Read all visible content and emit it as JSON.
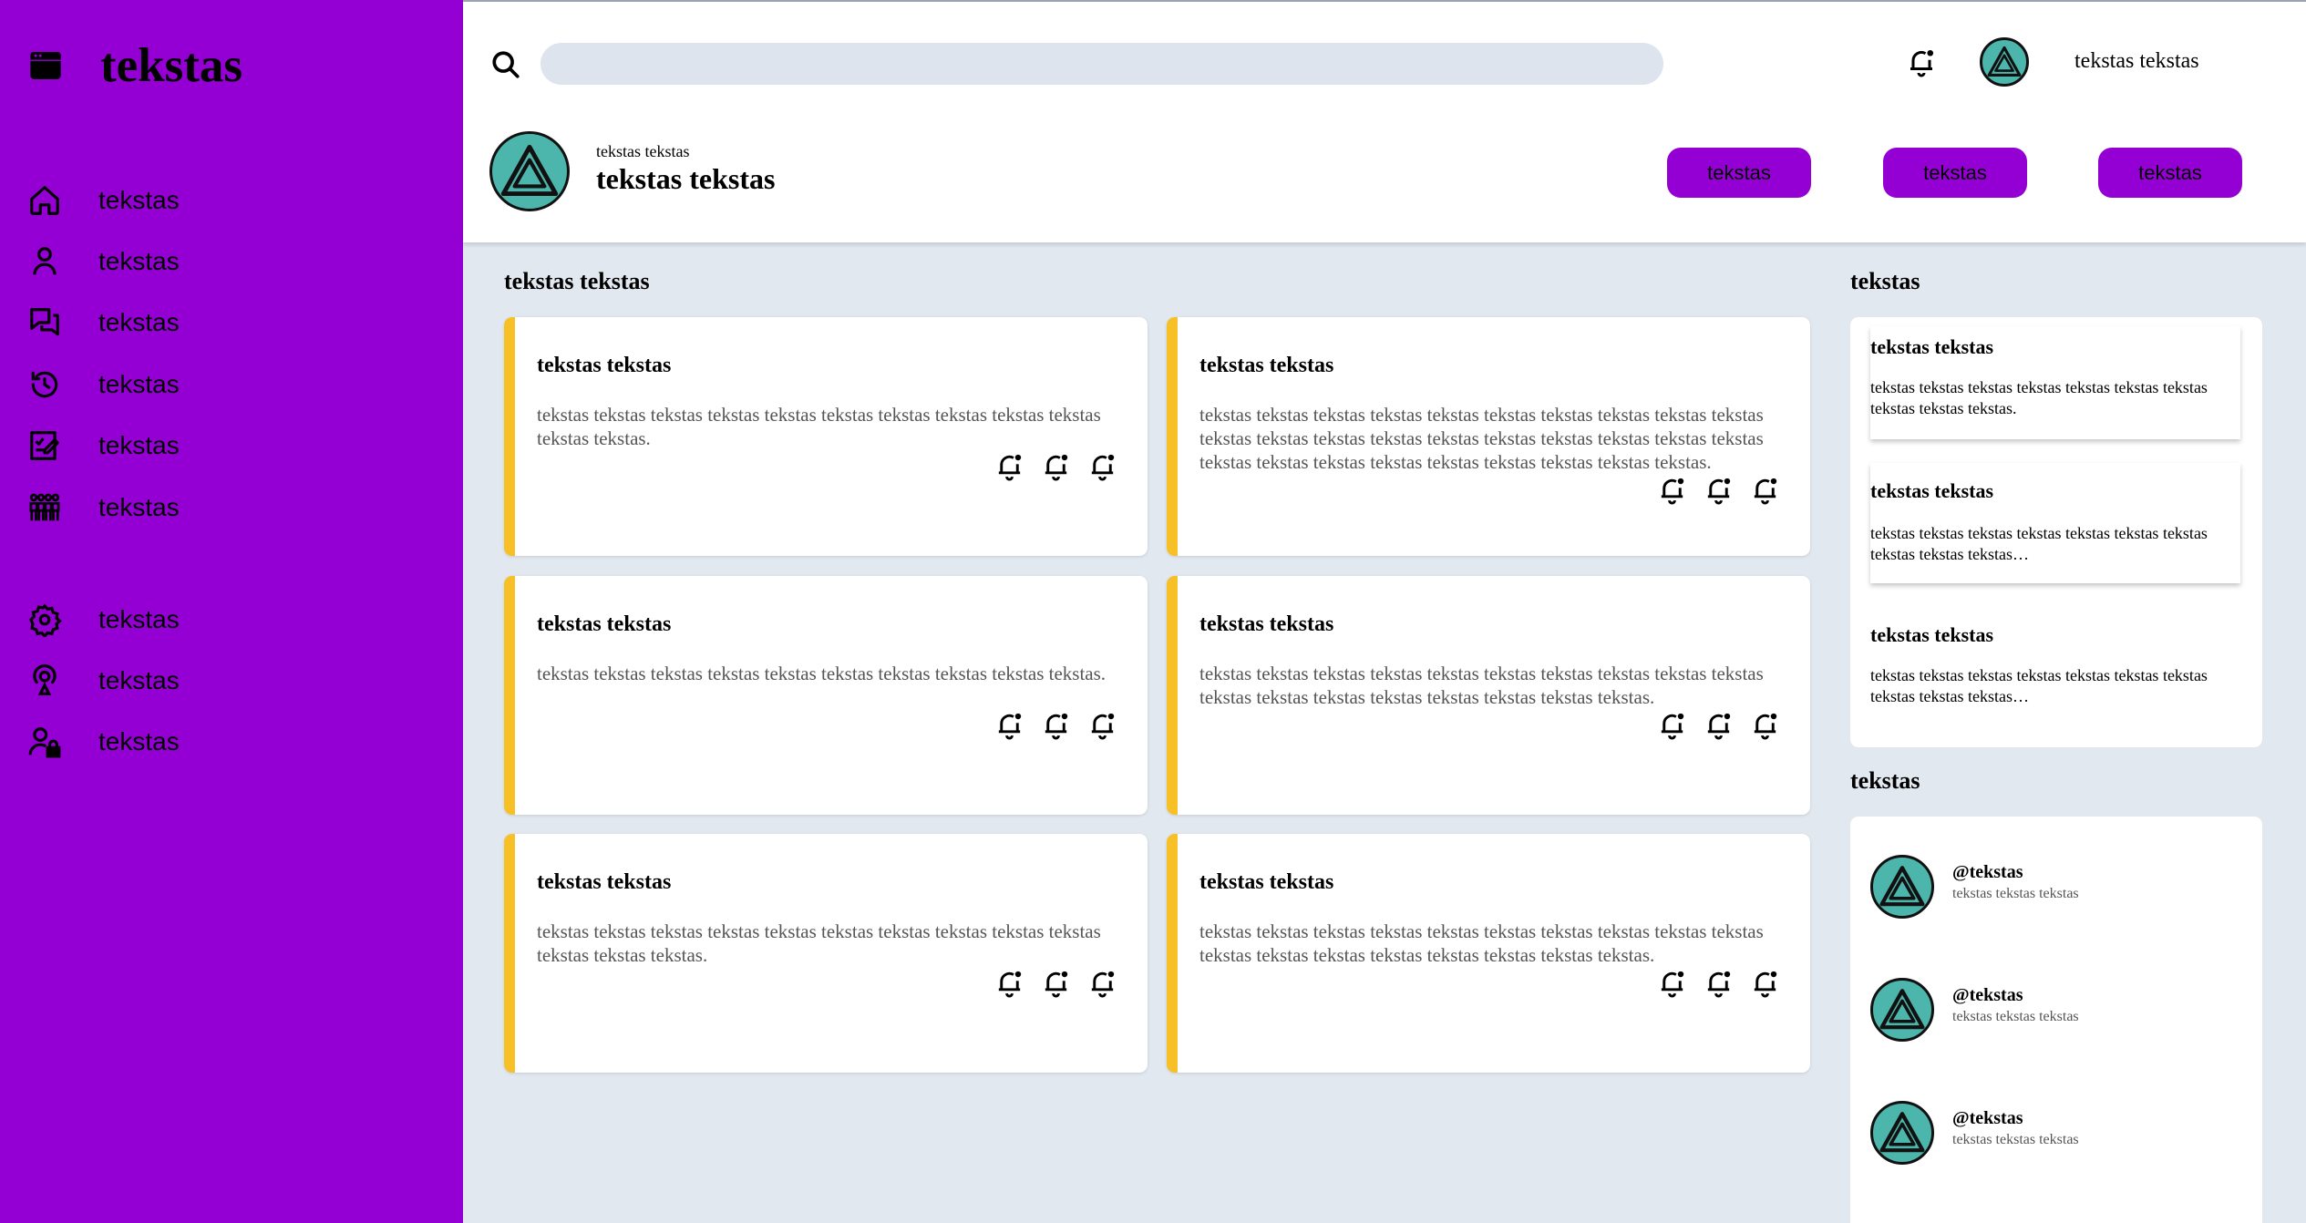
{
  "sidebar": {
    "brand_icon": "app-window-icon",
    "title": "tekstas",
    "items": [
      {
        "icon": "home-icon",
        "label": "tekstas"
      },
      {
        "icon": "user-icon",
        "label": "tekstas"
      },
      {
        "icon": "chat-icon",
        "label": "tekstas"
      },
      {
        "icon": "history-icon",
        "label": "tekstas"
      },
      {
        "icon": "edit-note-icon",
        "label": "tekstas"
      },
      {
        "icon": "group-icon",
        "label": "tekstas"
      }
    ],
    "secondary_items": [
      {
        "icon": "gear-icon",
        "label": "tekstas"
      },
      {
        "icon": "podcast-icon",
        "label": "tekstas"
      },
      {
        "icon": "user-lock-icon",
        "label": "tekstas"
      }
    ]
  },
  "header": {
    "search": {
      "placeholder": "",
      "value": ""
    },
    "user_name": "tekstas tekstas",
    "profile_greeting": "tekstas tekstas",
    "profile_name": "tekstas tekstas",
    "buttons": [
      "tekstas",
      "tekstas",
      "tekstas"
    ]
  },
  "main": {
    "section_title": "tekstas tekstas",
    "projects": [
      {
        "title": "tekstas tekstas",
        "text": "tekstas tekstas tekstas tekstas tekstas tekstas tekstas tekstas tekstas tekstas tekstas tekstas."
      },
      {
        "title": "tekstas tekstas",
        "text": "tekstas tekstas tekstas tekstas tekstas tekstas tekstas tekstas tekstas tekstas tekstas tekstas tekstas tekstas tekstas tekstas tekstas tekstas tekstas tekstas tekstas tekstas tekstas tekstas tekstas tekstas tekstas tekstas tekstas."
      },
      {
        "title": "tekstas tekstas",
        "text": "tekstas tekstas tekstas tekstas tekstas tekstas tekstas tekstas tekstas tekstas."
      },
      {
        "title": "tekstas tekstas",
        "text": "tekstas tekstas tekstas tekstas tekstas tekstas tekstas tekstas tekstas tekstas tekstas tekstas tekstas tekstas tekstas tekstas tekstas tekstas."
      },
      {
        "title": "tekstas tekstas",
        "text": "tekstas tekstas tekstas tekstas tekstas tekstas tekstas tekstas tekstas tekstas tekstas tekstas tekstas."
      },
      {
        "title": "tekstas tekstas",
        "text": "tekstas tekstas tekstas tekstas tekstas tekstas tekstas tekstas tekstas tekstas tekstas tekstas tekstas tekstas tekstas tekstas tekstas tekstas."
      }
    ],
    "card_action_icon": "bell-icon"
  },
  "right": {
    "announcements_title": "tekstas",
    "announcements": [
      {
        "title": "tekstas tekstas",
        "text": "tekstas tekstas tekstas tekstas tekstas tekstas tekstas tekstas tekstas tekstas."
      },
      {
        "title": "tekstas tekstas",
        "text": "tekstas tekstas tekstas tekstas tekstas tekstas tekstas tekstas tekstas tekstas…"
      },
      {
        "title": "tekstas tekstas",
        "text": "tekstas tekstas tekstas tekstas tekstas tekstas tekstas tekstas tekstas tekstas…"
      }
    ],
    "trending_title": "tekstas",
    "trending": [
      {
        "handle": "@tekstas",
        "sub": "tekstas tekstas tekstas"
      },
      {
        "handle": "@tekstas",
        "sub": "tekstas tekstas tekstas"
      },
      {
        "handle": "@tekstas",
        "sub": "tekstas tekstas tekstas"
      }
    ]
  },
  "colors": {
    "sidebar": "#9400d3",
    "accent_button": "#9400d3",
    "card_border": "#f6c026",
    "avatar": "#4db6ac",
    "background": "#e2e8f0"
  }
}
